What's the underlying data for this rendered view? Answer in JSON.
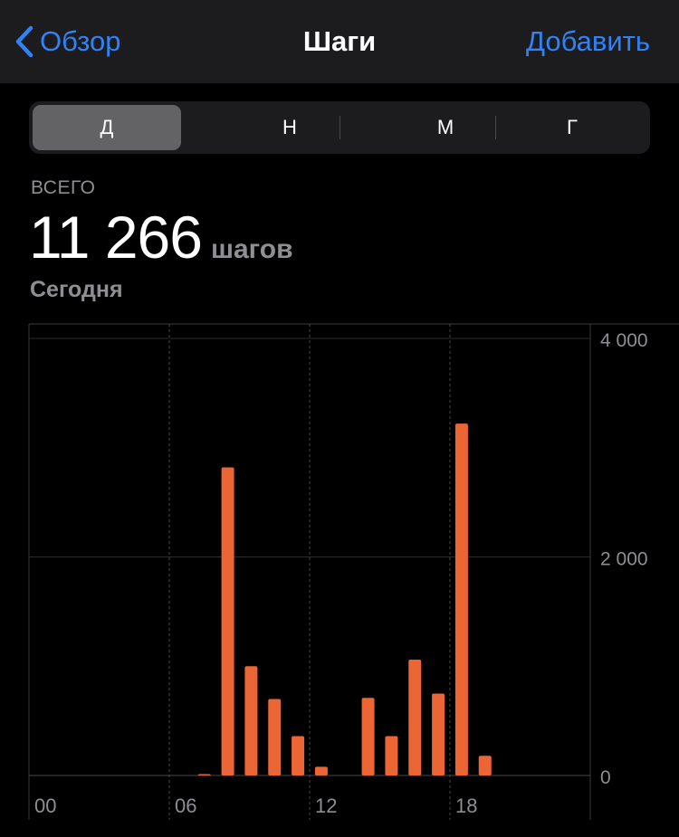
{
  "nav": {
    "back_label": "Обзор",
    "title": "Шаги",
    "add_label": "Добавить"
  },
  "segments": [
    {
      "label": "Д",
      "active": true
    },
    {
      "label": "Н",
      "active": false
    },
    {
      "label": "М",
      "active": false
    },
    {
      "label": "Г",
      "active": false
    }
  ],
  "summary": {
    "label": "ВСЕГО",
    "value": "11 266",
    "unit": "шагов",
    "date": "Сегодня"
  },
  "colors": {
    "accent": "#2f83f6",
    "bar": "#ec6535",
    "navbar_bg": "#1c1c1e",
    "segment_active": "#636366",
    "secondary_text": "#8e8e93"
  },
  "chart_data": {
    "type": "bar",
    "x": [
      0,
      1,
      2,
      3,
      4,
      5,
      6,
      7,
      8,
      9,
      10,
      11,
      12,
      13,
      14,
      15,
      16,
      17,
      18,
      19,
      20,
      21,
      22,
      23
    ],
    "x_ticks": [
      0,
      6,
      12,
      18
    ],
    "x_tick_labels": [
      "00",
      "06",
      "12",
      "18"
    ],
    "values": [
      0,
      0,
      0,
      0,
      0,
      0,
      0,
      10,
      2820,
      1000,
      700,
      360,
      80,
      0,
      710,
      360,
      1060,
      750,
      3220,
      180,
      0,
      0,
      0,
      0
    ],
    "ylim": [
      0,
      4000
    ],
    "y_ticks": [
      0,
      2000,
      4000
    ],
    "y_tick_labels": [
      "0",
      "2 000",
      "4 000"
    ],
    "grid": true
  }
}
